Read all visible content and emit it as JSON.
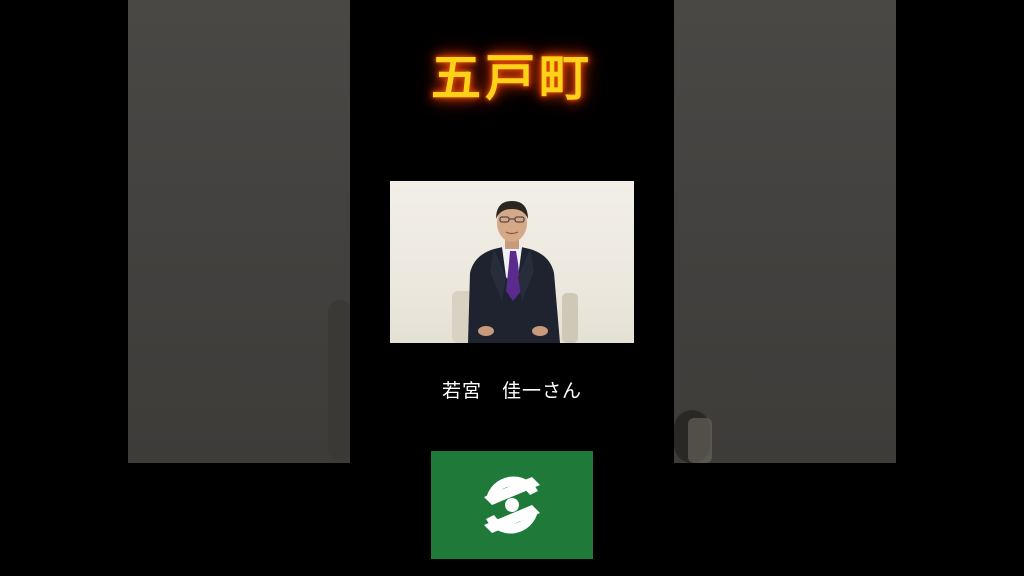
{
  "title": "五戸町",
  "caption": "若宮　佳一さん",
  "colors": {
    "title_fill": "#ffd21a",
    "title_glow": "#ff5a00",
    "emblem_background": "#1f7a39",
    "emblem_mark": "#ffffff"
  },
  "images": {
    "portrait": "man-in-suit-portrait",
    "emblem": "town-emblem-flag"
  }
}
